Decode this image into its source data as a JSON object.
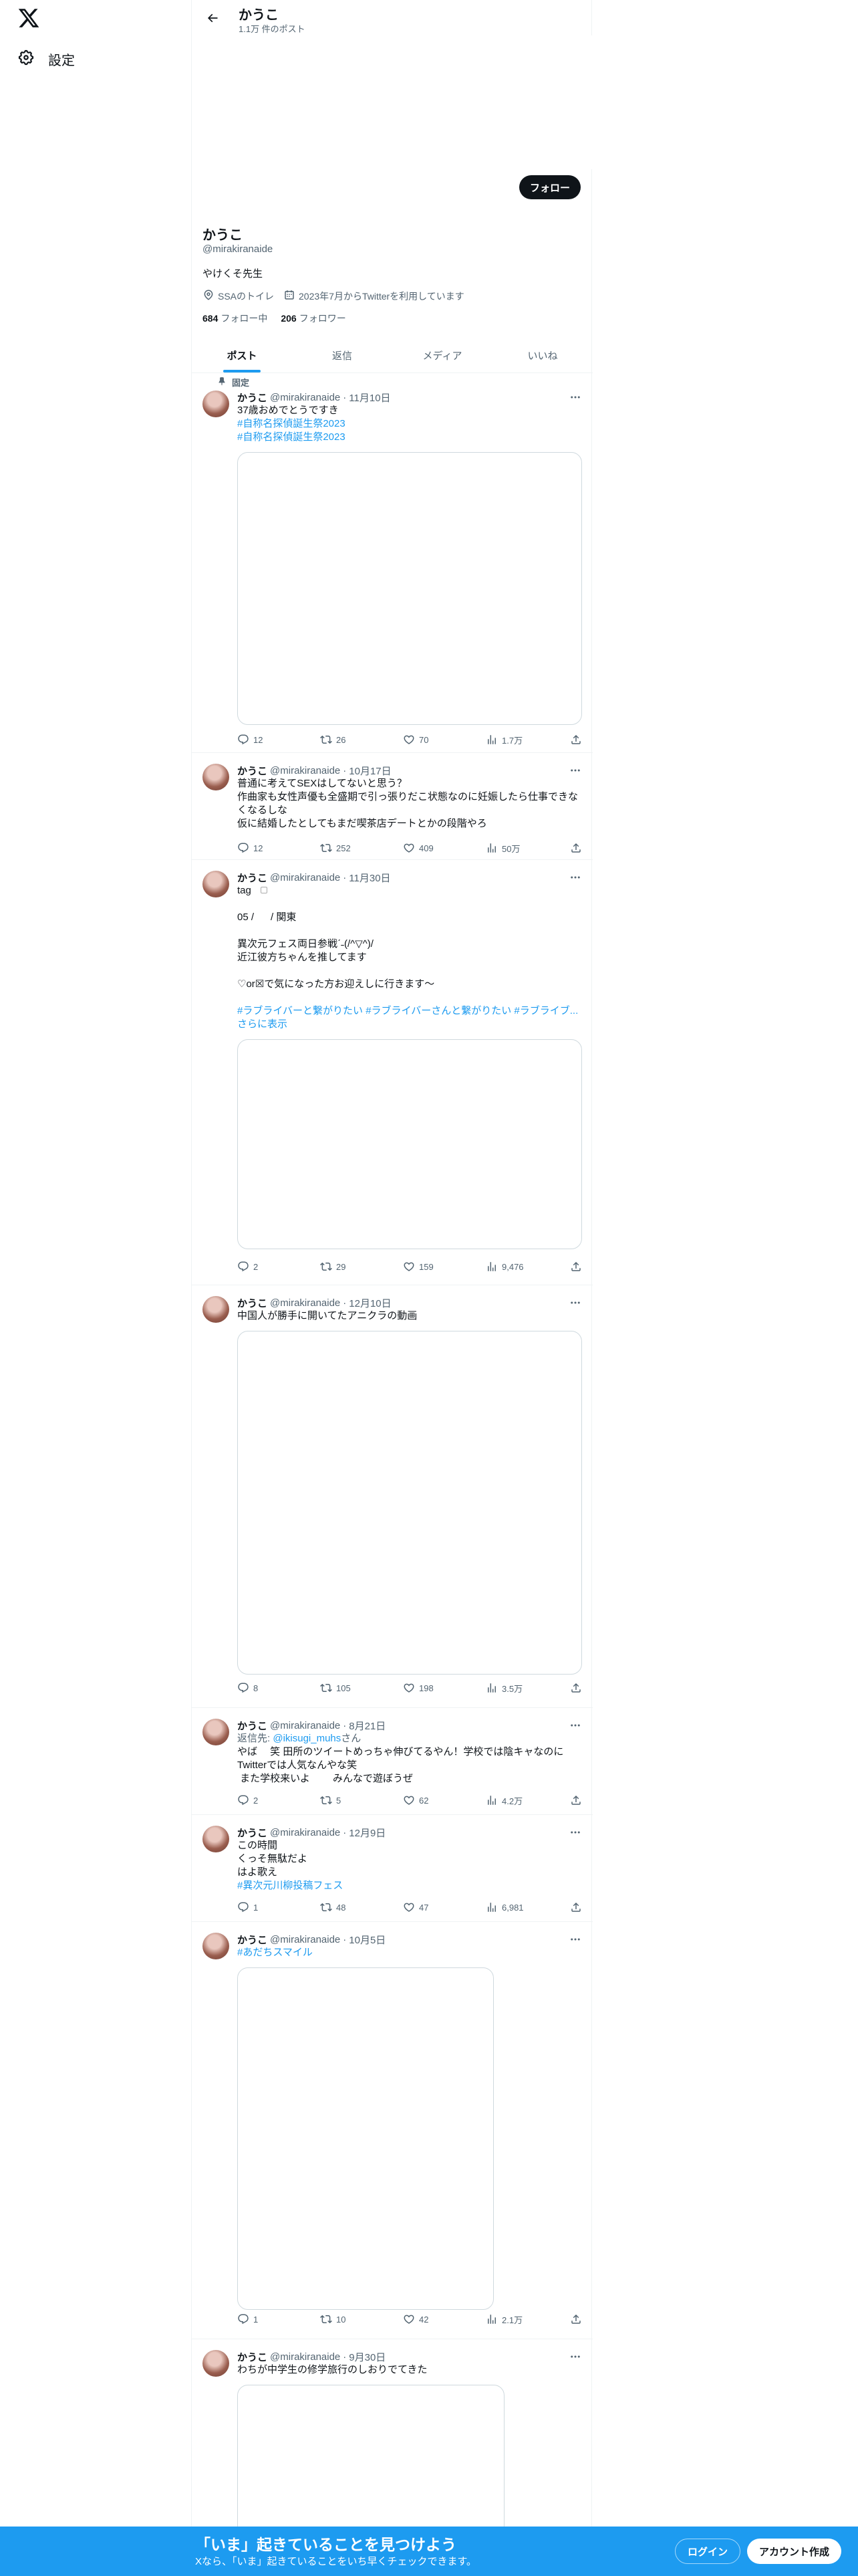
{
  "sidebar": {
    "settings_label": "設定"
  },
  "header": {
    "name": "かうこ",
    "post_count": "1.1万 件のポスト"
  },
  "profile": {
    "follow_label": "フォロー",
    "name": "かうこ",
    "handle": "@mirakiranaide",
    "bio": "やけくそ先生",
    "location": "SSAのトイレ",
    "joined": "2023年7月からTwitterを利用しています",
    "following_count": "684",
    "following_label": "フォロー中",
    "followers_count": "206",
    "followers_label": "フォロワー"
  },
  "tabs": [
    "ポスト",
    "返信",
    "メディア",
    "いいね"
  ],
  "pinned_label": "固定",
  "tweets": [
    {
      "name": "かうこ",
      "handle": "@mirakiranaide",
      "date": "11月10日",
      "lines": [
        "37歳おめでとうですき"
      ],
      "links": [
        "#自称名探偵誕生祭2023",
        "#自称名探偵誕生祭2023"
      ],
      "replies": "12",
      "retweets": "26",
      "likes": "70",
      "views": "1.7万"
    },
    {
      "name": "かうこ",
      "handle": "@mirakiranaide",
      "date": "10月17日",
      "text": "普通に考えてSEXはしてないと思う？\n作曲家も女性声優も全盛期で引っ張りだこ状態なのに妊娠したら仕事できなくなるしな\n仮に結婚したとしてもまだ喫茶店デートとかの段階やろ",
      "replies": "12",
      "retweets": "252",
      "likes": "409",
      "views": "50万"
    },
    {
      "name": "かうこ",
      "handle": "@mirakiranaide",
      "date": "11月30日",
      "tag_line": "tag",
      "text": "05 /      / 関東\n\n異次元フェス両日参戦ˊ˗(/^▽^)/\n近江彼方ちゃんを推してます\n\n♡or☒で気になった方お迎えしに行きます〜",
      "hashtags": "#ラブライバーと繋がりたい #ラブライバーさんと繋がりたい #ラブライブ...",
      "show_more": "さらに表示",
      "replies": "2",
      "retweets": "29",
      "likes": "159",
      "views": "9,476"
    },
    {
      "name": "かうこ",
      "handle": "@mirakiranaide",
      "date": "12月10日",
      "text": "中国人が勝手に開いてたアニクラの動画",
      "replies": "8",
      "retweets": "105",
      "likes": "198",
      "views": "3.5万"
    },
    {
      "name": "かうこ",
      "handle": "@mirakiranaide",
      "date": "8月21日",
      "reply_prefix": "返信先: ",
      "reply_to": "@ikisugi_muhs",
      "reply_suffix": "さん",
      "text": "やば　 笑 田所のツイートめっちゃ伸びてるやん！学校では陰キャなのにTwitterでは人気なんやな笑\n また学校来いよ　　 みんなで遊ぼうぜ",
      "replies": "2",
      "retweets": "5",
      "likes": "62",
      "views": "4.2万"
    },
    {
      "name": "かうこ",
      "handle": "@mirakiranaide",
      "date": "12月9日",
      "text": "この時間\nくっそ無駄だよ\nはよ歌え",
      "link": "#異次元川柳投稿フェス",
      "replies": "1",
      "retweets": "48",
      "likes": "47",
      "views": "6,981"
    },
    {
      "name": "かうこ",
      "handle": "@mirakiranaide",
      "date": "10月5日",
      "link": "#あだちスマイル",
      "replies": "1",
      "retweets": "10",
      "likes": "42",
      "views": "2.1万"
    },
    {
      "name": "かうこ",
      "handle": "@mirakiranaide",
      "date": "9月30日",
      "text": "わちが中学生の修学旅行のしおりでてきた"
    }
  ],
  "bottom_bar": {
    "title": "「いま」起きていることを見つけよう",
    "subtitle": "Xなら、「いま」起きていることをいち早くチェックできます。",
    "login_label": "ログイン",
    "signup_label": "アカウント作成"
  },
  "colors": {
    "accent": "#1d9bf0",
    "text": "#0f1419",
    "muted": "#536471"
  }
}
